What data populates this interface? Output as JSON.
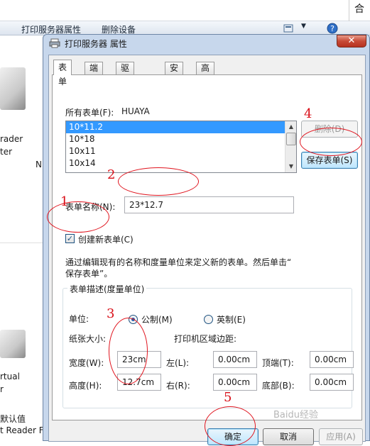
{
  "background": {
    "toolbar": {
      "printer_server_properties": "打印服务器属性",
      "remove_device": "删除设备"
    },
    "top_right_text": "合",
    "left_fragments": [
      "rader",
      "ter",
      "N",
      "rtual",
      "r",
      "默认值",
      "t Reader F"
    ]
  },
  "dialog": {
    "title": "打印服务器 属性",
    "close_glyph": "✕",
    "tabs": [
      "表单",
      "端口",
      "驱动程序",
      "安全",
      "高级"
    ],
    "all_forms_label": "所有表单(F):",
    "server_name": "HUAYA",
    "forms_list": [
      "10*11.2",
      "10*18",
      "10x11",
      "10x14"
    ],
    "selected_form": "10*11.2",
    "delete_button": "删除(D)",
    "save_button": "保存表单(S)",
    "form_name_label": "表单名称(N):",
    "form_name_value": "23*12.7",
    "create_new_label": "创建新表单(C)",
    "create_new_checked": "✓",
    "help_text_line1": "通过编辑现有的名称和度量单位来定义新的表单。然后单击“",
    "help_text_line2": "保存表单”。",
    "group_title": "表单描述(度量单位)",
    "unit_label": "单位:",
    "metric_label": "公制(M)",
    "imperial_label": "英制(E)",
    "paper_size_label": "纸张大小:",
    "margins_label": "打印机区域边距:",
    "width_label": "宽度(W):",
    "width_value": "23cm",
    "height_label": "高度(H):",
    "height_value": "12.7cm",
    "left_label": "左(L):",
    "left_value": "0.00cm",
    "right_label": "右(R):",
    "right_value": "0.00cm",
    "top_label": "顶端(T):",
    "top_value": "0.00cm",
    "bottom_label": "底部(B):",
    "bottom_value": "0.00cm",
    "ok_button": "确定",
    "cancel_button": "取消",
    "apply_button": "应用(A)"
  },
  "annotations": {
    "n1": "1",
    "n2": "2",
    "n3": "3",
    "n4": "4",
    "n5": "5",
    "color": "#e0141e"
  },
  "watermark": "Baidu经验"
}
